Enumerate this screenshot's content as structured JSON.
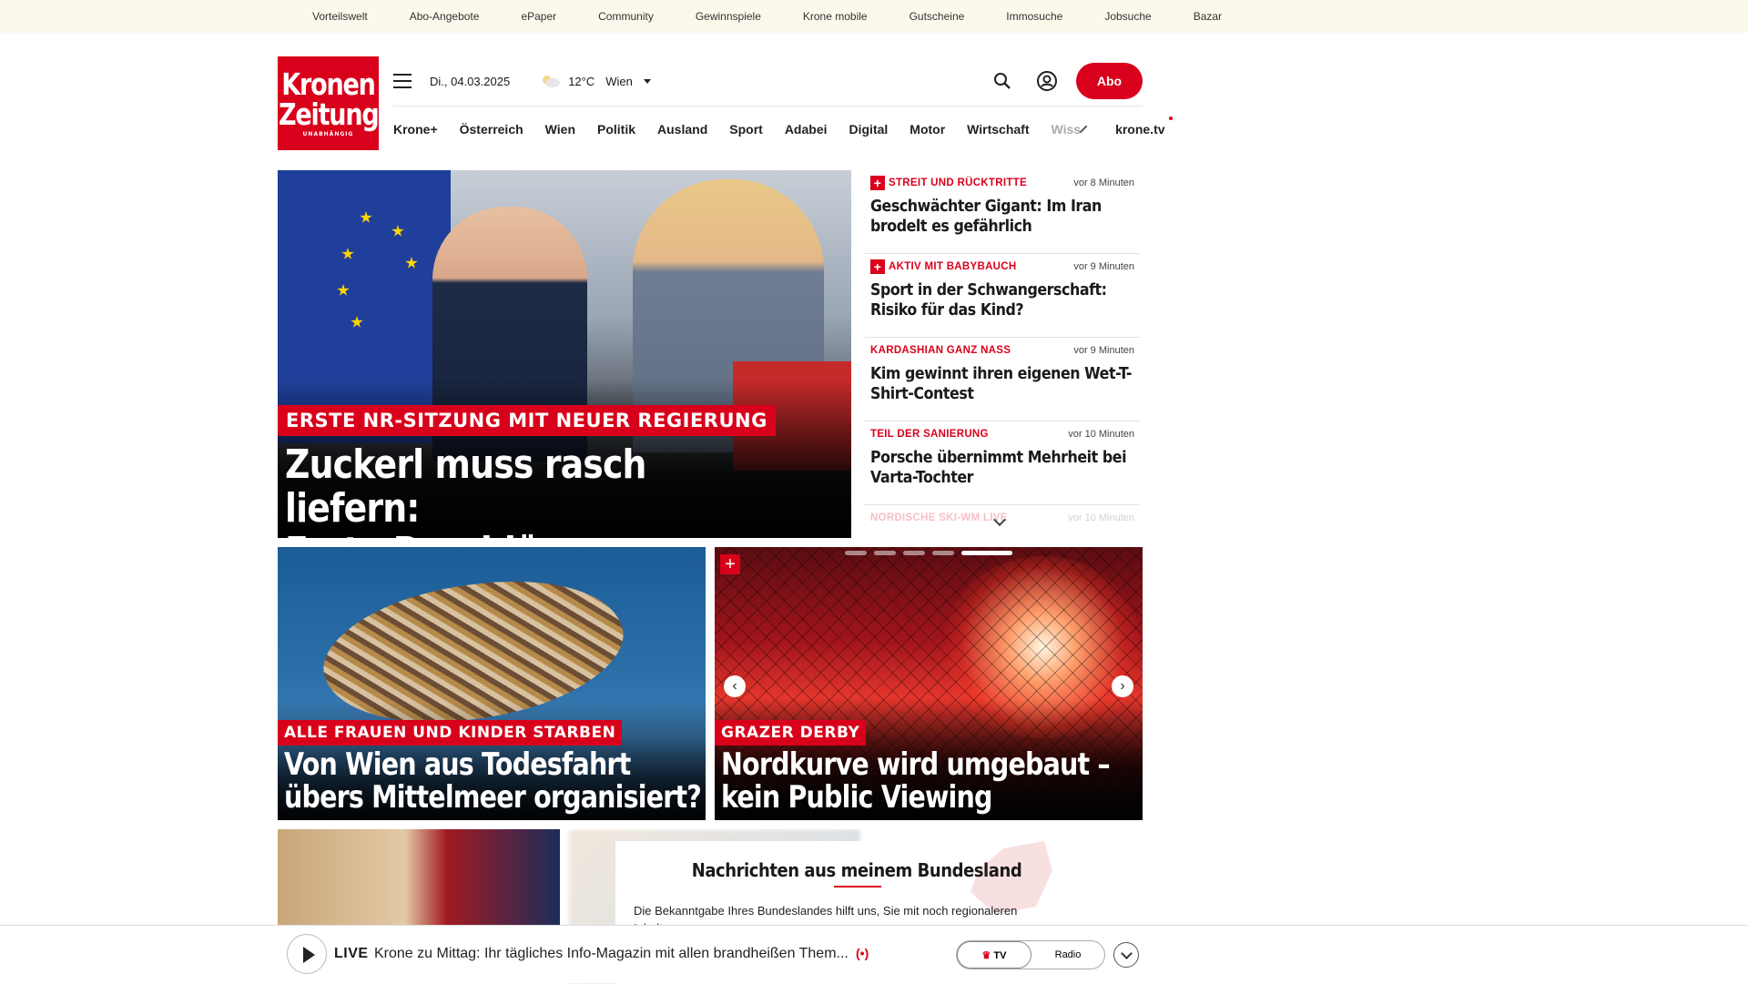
{
  "topbar": {
    "links": [
      "Vorteilswelt",
      "Abo-Angebote",
      "ePaper",
      "Community",
      "Gewinnspiele",
      "Krone mobile",
      "Gutscheine",
      "Immosuche",
      "Jobsuche",
      "Bazar"
    ]
  },
  "logo": {
    "line1": "Kronen",
    "line2": "Zeitung",
    "line3": "UNABHÄNGIG"
  },
  "header": {
    "date": "Di., 04.03.2025",
    "weather_icon": "partly-cloudy-icon",
    "temperature": "12°C",
    "city": "Wien",
    "abo_label": "Abo"
  },
  "nav": {
    "items": [
      "Krone+",
      "Österreich",
      "Wien",
      "Politik",
      "Ausland",
      "Sport",
      "Adabei",
      "Digital",
      "Motor",
      "Wirtschaft",
      "Wiss"
    ],
    "tv": "krone.tv"
  },
  "hero": {
    "kicker": "ERSTE NR-SITZUNG MIT NEUER REGIERUNG",
    "title_line1": "Zuckerl muss rasch liefern:",
    "title_line2": "Erste Beschlüsse am Freitag"
  },
  "sidelist": {
    "items": [
      {
        "category": "STREIT UND RÜCKTRITTE",
        "time": "vor 8 Minuten",
        "headline": "Geschwächter Gigant: Im Iran brodelt es gefährlich",
        "plus": true
      },
      {
        "category": "AKTIV MIT BABYBAUCH",
        "time": "vor 9 Minuten",
        "headline": "Sport in der Schwangerschaft: Risiko für das Kind?",
        "plus": true
      },
      {
        "category": "KARDASHIAN GANZ NASS",
        "time": "vor 9 Minuten",
        "headline": "Kim gewinnt ihren eigenen Wet-T-Shirt-Contest",
        "plus": false
      },
      {
        "category": "TEIL DER SANIERUNG",
        "time": "vor 10 Minuten",
        "headline": "Porsche übernimmt Mehrheit bei Varta-Tochter",
        "plus": false
      },
      {
        "category": "NORDISCHE SKI-WM LIVE",
        "time": "vor 10 Minuten",
        "headline": "",
        "plus": false
      }
    ]
  },
  "cards": [
    {
      "kicker": "ALLE FRAUEN UND KINDER STARBEN",
      "title_line1": "Von Wien aus Todesfahrt",
      "title_line2": "übers Mittelmeer organisiert?"
    },
    {
      "kicker": "GRAZER DERBY",
      "title_line1": "Nordkurve wird umgebaut –",
      "title_line2": "kein Public Viewing"
    }
  ],
  "carousel": {
    "prev": "‹",
    "next": "›",
    "plus": "+"
  },
  "promo": {
    "title": "Nachrichten aus meinem Bundesland",
    "text": "Die Bekanntgabe Ihres Bundeslandes hilft uns, Sie mit noch regionaleren Inhalten zu versorgen."
  },
  "player": {
    "live": "LIVE",
    "title": "Krone zu Mittag: Ihr tägliches Info-Magazin mit allen brandheißen Them...",
    "radio_icon": "(•)",
    "tv_label": "TV",
    "radio_label": "Radio"
  }
}
